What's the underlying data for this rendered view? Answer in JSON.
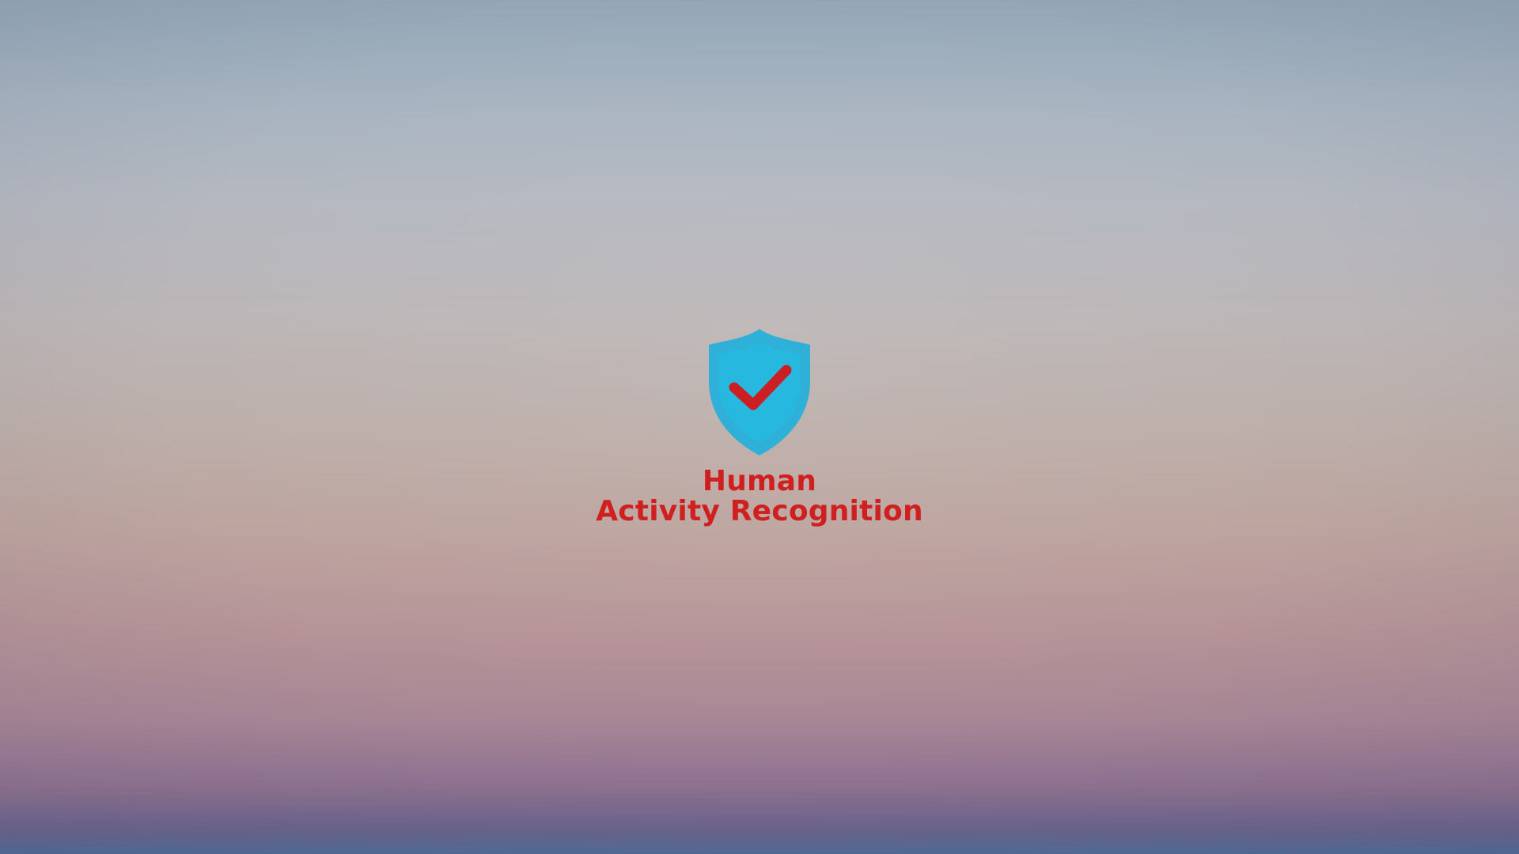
{
  "splash": {
    "logo_icon": "shield-check-icon",
    "title_line1": "Human",
    "title_line2": "Activity Recognition"
  },
  "colors": {
    "shield_outer": "#2fb0d8",
    "shield_inner": "#27b8e0",
    "check": "#cc1f24",
    "title": "#cf1f1f"
  }
}
